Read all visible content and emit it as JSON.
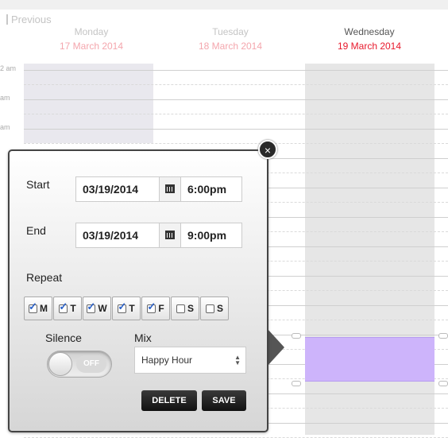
{
  "nav": {
    "previous_label": "Previous"
  },
  "days": [
    {
      "name": "Monday",
      "date": "17 March 2014"
    },
    {
      "name": "Tuesday",
      "date": "18 March 2014"
    },
    {
      "name": "Wednesday",
      "date": "19 March 2014"
    }
  ],
  "hour_labels": [
    "2 am",
    "am",
    "am"
  ],
  "editor": {
    "close_glyph": "×",
    "start_label": "Start",
    "start_date": "03/19/2014",
    "start_time": "6:00pm",
    "end_label": "End",
    "end_date": "03/19/2014",
    "end_time": "9:00pm",
    "repeat_label": "Repeat",
    "repeat_days": [
      {
        "letter": "M",
        "checked": true
      },
      {
        "letter": "T",
        "checked": true
      },
      {
        "letter": "W",
        "checked": true
      },
      {
        "letter": "T",
        "checked": true
      },
      {
        "letter": "F",
        "checked": true
      },
      {
        "letter": "S",
        "checked": false
      },
      {
        "letter": "S",
        "checked": false
      }
    ],
    "silence_label": "Silence",
    "silence_state": "OFF",
    "mix_label": "Mix",
    "mix_value": "Happy Hour",
    "delete_label": "DELETE",
    "save_label": "SAVE"
  },
  "colors": {
    "accent_date": "#e8192c",
    "event": "#cdb4fb"
  }
}
